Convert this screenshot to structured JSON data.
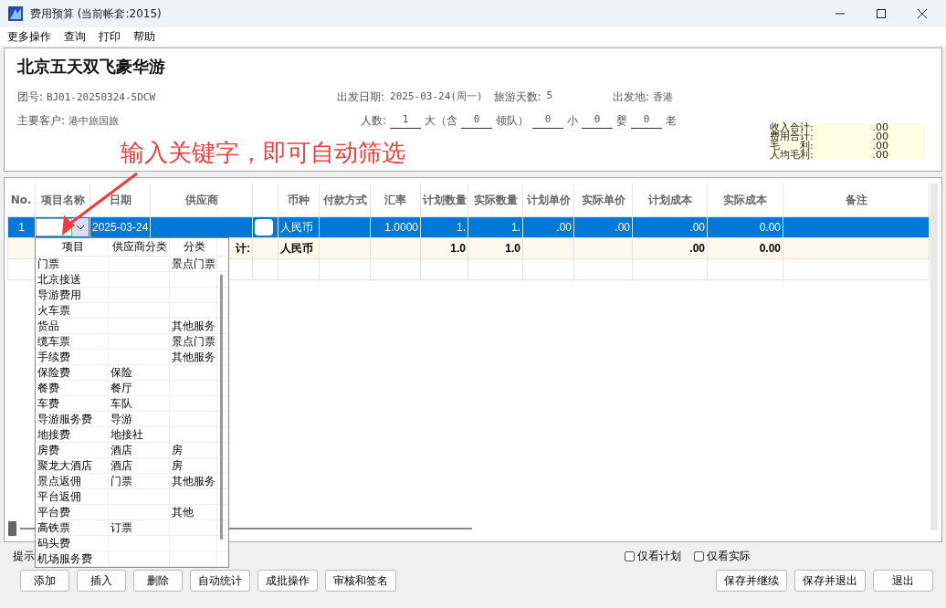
{
  "window": {
    "title": "费用预算 (当前帐套:2015)"
  },
  "menu": [
    "更多操作",
    "查询",
    "打印",
    "帮助"
  ],
  "tour": {
    "name": "北京五天双飞豪华游",
    "group_no_label": "团号:",
    "group_no": "BJ01-20250324-5DCW",
    "depart_date_label": "出发日期:",
    "depart_date": "2025-03-24(周一)",
    "days_label": "旅游天数:",
    "days": "5",
    "origin_label": "出发地:",
    "origin": "香港",
    "customer_label": "主要客户:",
    "customer": "港中旅国旅",
    "people_label": "人数:",
    "people": [
      {
        "value": "1",
        "unit": "大（含"
      },
      {
        "value": "0",
        "unit": "领队）"
      },
      {
        "value": "0",
        "unit": "小"
      },
      {
        "value": "0",
        "unit": "婴"
      },
      {
        "value": "0",
        "unit": "老"
      }
    ]
  },
  "totals": [
    {
      "label": "收入合计:",
      "value": ".00"
    },
    {
      "label": "费用合计:",
      "value": ".00"
    },
    {
      "label": "毛　　利:",
      "value": ".00"
    },
    {
      "label": "人均毛利:",
      "value": ".00"
    }
  ],
  "annotation": {
    "text": "输入关键字，即可自动筛选"
  },
  "grid": {
    "columns": [
      {
        "label": "No.",
        "kind": "text"
      },
      {
        "label": "项目名称",
        "kind": "combo"
      },
      {
        "label": "日期",
        "kind": "text"
      },
      {
        "label": "供应商",
        "kind": "text"
      },
      {
        "kind": "toggle"
      },
      {
        "label": "币种",
        "kind": "text"
      },
      {
        "label": "付款方式",
        "kind": "text"
      },
      {
        "label": "汇率",
        "kind": "text"
      },
      {
        "label": "计划数量",
        "kind": "text"
      },
      {
        "label": "实际数量",
        "kind": "text"
      },
      {
        "label": "计划单价",
        "kind": "text"
      },
      {
        "label": "实际单价",
        "kind": "text"
      },
      {
        "label": "计划成本",
        "kind": "text"
      },
      {
        "label": "实际成本",
        "kind": "text"
      },
      {
        "label": "备注",
        "kind": "text"
      }
    ],
    "rows": [
      {
        "kind": "editing",
        "selected": true,
        "cells": [
          "1",
          null,
          "2025-03-24",
          null,
          null,
          "人民币",
          null,
          "1.0000",
          "1.",
          "1.",
          ".00",
          ".00",
          ".00",
          "0.00",
          null
        ]
      },
      {
        "kind": "total",
        "selected": false,
        "cells": [
          null,
          null,
          null,
          "计:",
          null,
          "人民币",
          null,
          null,
          "1.0",
          "1.0",
          null,
          null,
          ".00",
          "0.00",
          null
        ]
      }
    ]
  },
  "dropdown": {
    "columns": [
      "项目",
      "供应商分类",
      "分类"
    ],
    "rows": [
      [
        "门票",
        null,
        "景点门票"
      ],
      [
        "北京接送",
        null,
        null
      ],
      [
        "导游费用",
        null,
        null
      ],
      [
        "火车票",
        null,
        null
      ],
      [
        "货品",
        null,
        "其他服务"
      ],
      [
        "缆车票",
        null,
        "景点门票"
      ],
      [
        "手续费",
        null,
        "其他服务"
      ],
      [
        "保险费",
        "保险",
        null
      ],
      [
        "餐费",
        "餐厅",
        null
      ],
      [
        "车费",
        "车队",
        null
      ],
      [
        "导游服务费",
        "导游",
        null
      ],
      [
        "地接费",
        "地接社",
        null
      ],
      [
        "房费",
        "酒店",
        "房"
      ],
      [
        "聚龙大酒店",
        "酒店",
        "房"
      ],
      [
        "景点返佣",
        "门票",
        "其他服务"
      ],
      [
        "平台返佣",
        null,
        null
      ],
      [
        "平台费",
        null,
        "其他"
      ],
      [
        "高铁票",
        "订票",
        null
      ],
      [
        "码头费",
        null,
        null
      ],
      [
        "机场服务费",
        null,
        null
      ]
    ]
  },
  "hint": "提示",
  "filters": [
    {
      "label": "仅看计划",
      "checked": false
    },
    {
      "label": "仅看实际",
      "checked": false
    }
  ],
  "buttons_left": [
    "添加",
    "插入",
    "删除",
    "自动统计",
    "成批操作",
    "审核和签名"
  ],
  "buttons_right": [
    "保存并继续",
    "保存并退出",
    "退出"
  ]
}
